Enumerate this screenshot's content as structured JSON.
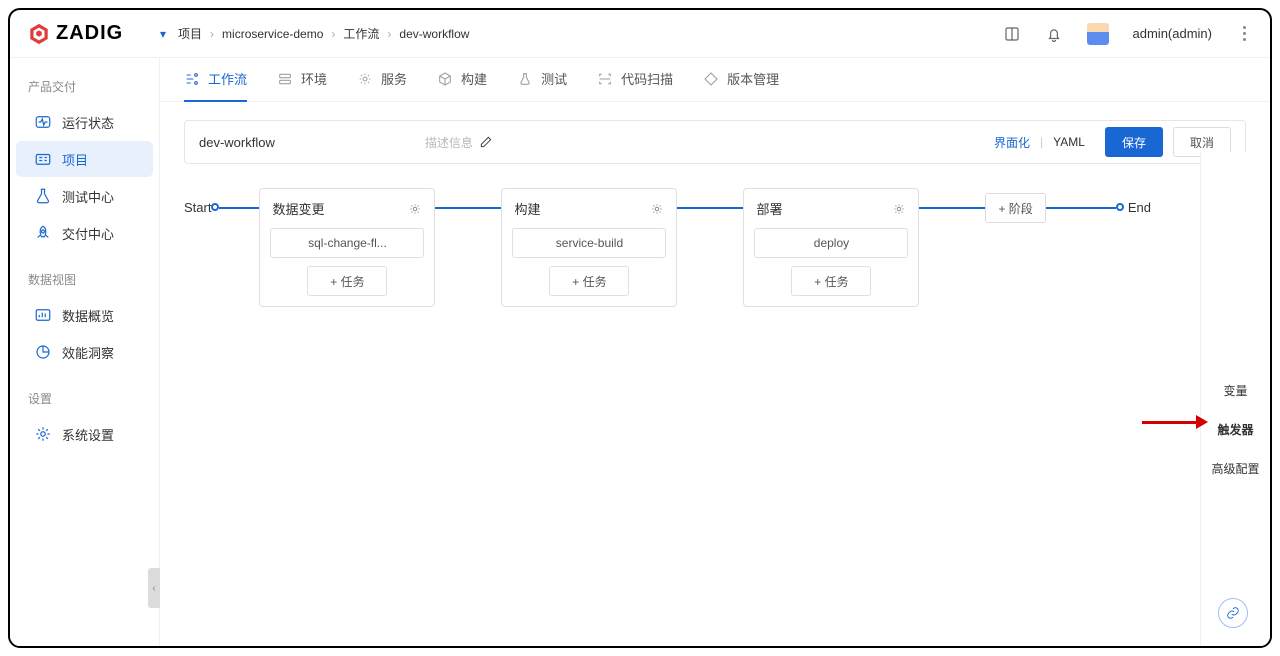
{
  "brand": "ZADIG",
  "breadcrumb": {
    "l1": "项目",
    "l2": "microservice-demo",
    "l3": "工作流",
    "l4": "dev-workflow"
  },
  "user": {
    "display": "admin(admin)"
  },
  "sidebar": {
    "sections": {
      "delivery": "产品交付",
      "dataview": "数据视图",
      "settings": "设置"
    },
    "items": {
      "status": "运行状态",
      "project": "项目",
      "testcenter": "测试中心",
      "deliverycenter": "交付中心",
      "dataoverview": "数据概览",
      "perfinsight": "效能洞察",
      "sysset": "系统设置"
    }
  },
  "tabs": {
    "workflow": "工作流",
    "env": "环境",
    "service": "服务",
    "build": "构建",
    "test": "测试",
    "scan": "代码扫描",
    "version": "版本管理"
  },
  "toolbar": {
    "workflow_name": "dev-workflow",
    "desc_placeholder": "描述信息",
    "mode_ui": "界面化",
    "mode_yaml": "YAML",
    "save": "保存",
    "cancel": "取消"
  },
  "pipeline": {
    "start": "Start",
    "end": "End",
    "add_stage": "+ 阶段",
    "add_task": "+ 任务",
    "stages": [
      {
        "title": "数据变更",
        "task": "sql-change-fl..."
      },
      {
        "title": "构建",
        "task": "service-build"
      },
      {
        "title": "部署",
        "task": "deploy"
      }
    ]
  },
  "rail": {
    "vars": "变量",
    "trigger": "触发器",
    "advanced": "高级配置"
  }
}
